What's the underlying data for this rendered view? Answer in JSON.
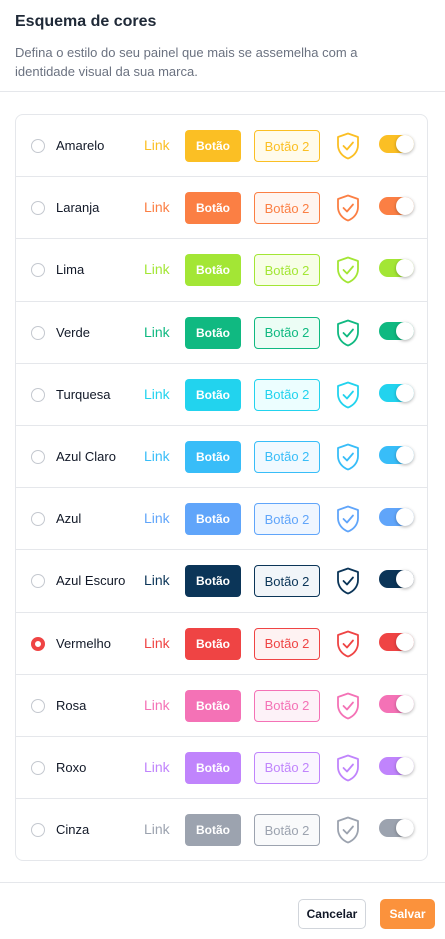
{
  "header": {
    "title": "Esquema de cores",
    "subtitle": "Defina o estilo do seu painel que mais se assemelha com a identidade visual da sua marca."
  },
  "schemes": [
    {
      "name": "Amarelo",
      "link_label": "Link",
      "button_label": "Botão",
      "button2_label": "Botão 2",
      "color": "#fbbf24",
      "light": "#fffbeb",
      "selected": false,
      "toggle_on": true
    },
    {
      "name": "Laranja",
      "link_label": "Link",
      "button_label": "Botão",
      "button2_label": "Botão 2",
      "color": "#fb7f44",
      "light": "#fff5f0",
      "selected": false,
      "toggle_on": true
    },
    {
      "name": "Lima",
      "link_label": "Link",
      "button_label": "Botão",
      "button2_label": "Botão 2",
      "color": "#a3e635",
      "light": "#f7fee7",
      "selected": false,
      "toggle_on": true
    },
    {
      "name": "Verde",
      "link_label": "Link",
      "button_label": "Botão",
      "button2_label": "Botão 2",
      "color": "#10b981",
      "light": "#ecfdf5",
      "selected": false,
      "toggle_on": true
    },
    {
      "name": "Turquesa",
      "link_label": "Link",
      "button_label": "Botão",
      "button2_label": "Botão 2",
      "color": "#22d3ee",
      "light": "#ecfeff",
      "selected": false,
      "toggle_on": true
    },
    {
      "name": "Azul Claro",
      "link_label": "Link",
      "button_label": "Botão",
      "button2_label": "Botão 2",
      "color": "#38bdf8",
      "light": "#f0f9ff",
      "selected": false,
      "toggle_on": true
    },
    {
      "name": "Azul",
      "link_label": "Link",
      "button_label": "Botão",
      "button2_label": "Botão 2",
      "color": "#60a5fa",
      "light": "#eff6ff",
      "selected": false,
      "toggle_on": true
    },
    {
      "name": "Azul Escuro",
      "link_label": "Link",
      "button_label": "Botão",
      "button2_label": "Botão 2",
      "color": "#0b3558",
      "light": "#f1f5f9",
      "selected": false,
      "toggle_on": true
    },
    {
      "name": "Vermelho",
      "link_label": "Link",
      "button_label": "Botão",
      "button2_label": "Botão 2",
      "color": "#ef4444",
      "light": "#fef2f2",
      "selected": true,
      "toggle_on": true
    },
    {
      "name": "Rosa",
      "link_label": "Link",
      "button_label": "Botão",
      "button2_label": "Botão 2",
      "color": "#f472b6",
      "light": "#fdf2f8",
      "selected": false,
      "toggle_on": true
    },
    {
      "name": "Roxo",
      "link_label": "Link",
      "button_label": "Botão",
      "button2_label": "Botão 2",
      "color": "#c084fc",
      "light": "#faf5ff",
      "selected": false,
      "toggle_on": true
    },
    {
      "name": "Cinza",
      "link_label": "Link",
      "button_label": "Botão",
      "button2_label": "Botão 2",
      "color": "#9ca3af",
      "light": "#f9fafb",
      "selected": false,
      "toggle_on": true
    }
  ],
  "footer": {
    "cancel_label": "Cancelar",
    "save_label": "Salvar",
    "save_color": "#fb923c"
  }
}
